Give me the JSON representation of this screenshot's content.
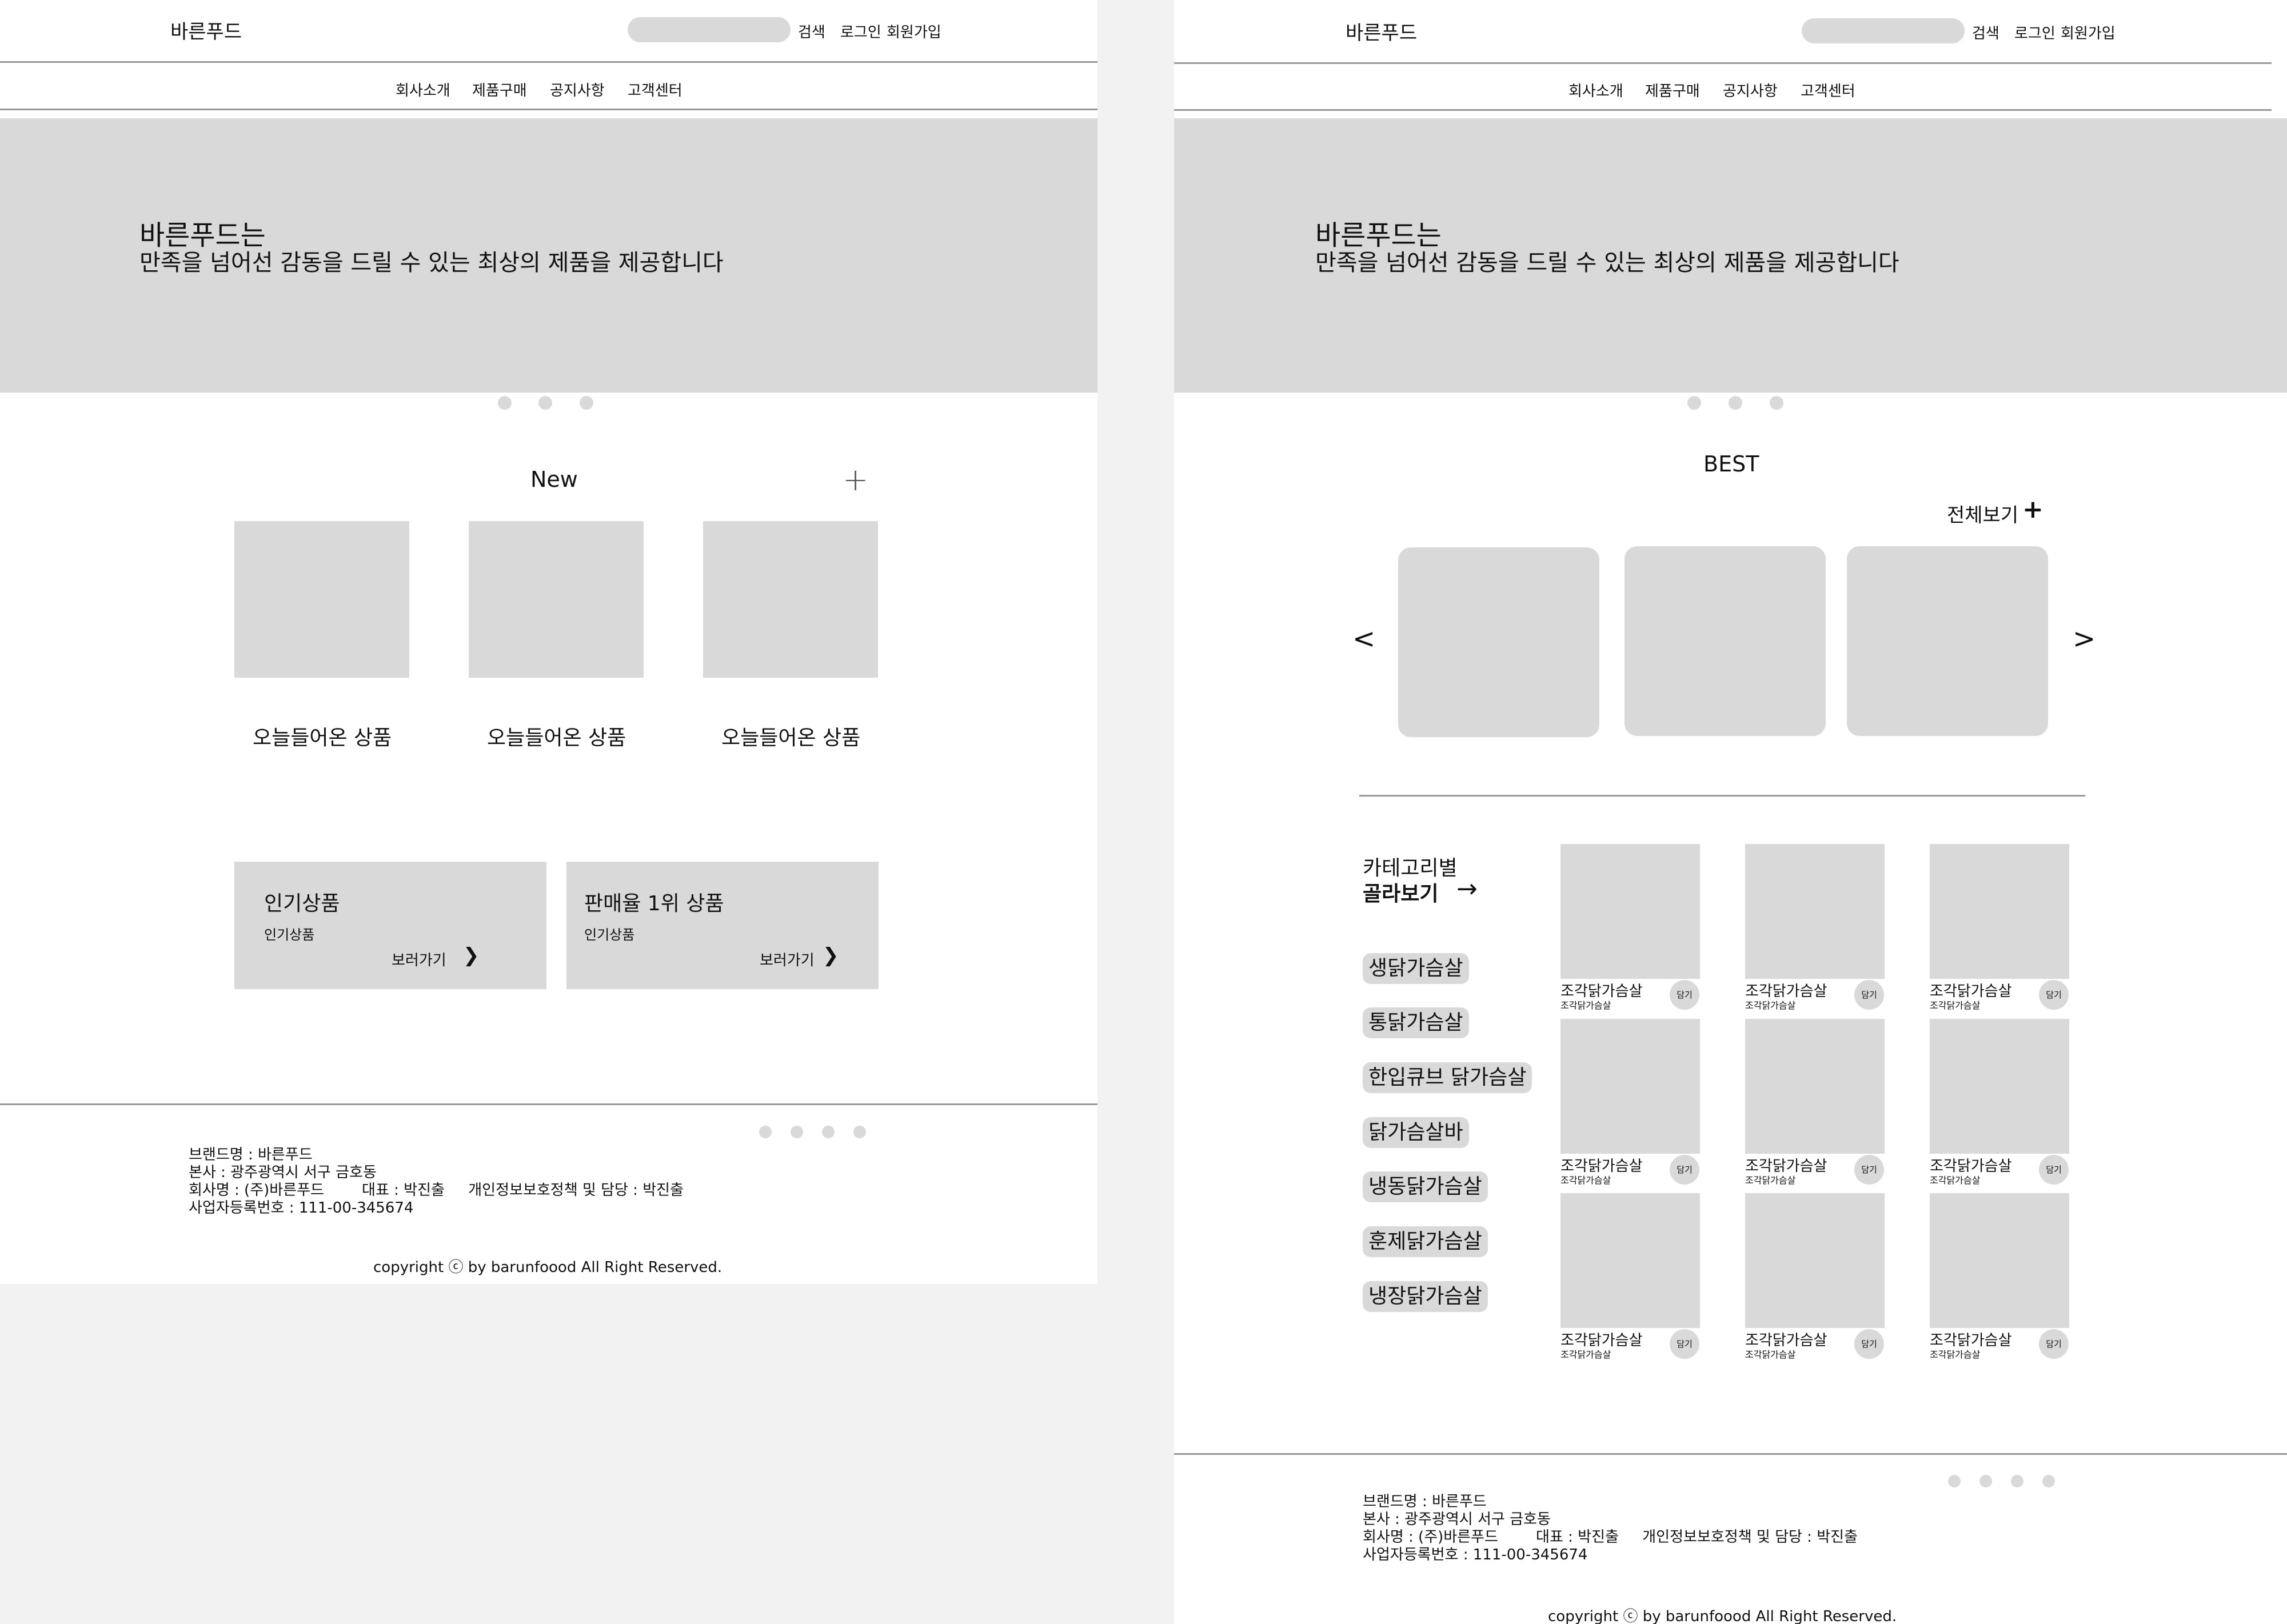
{
  "pageA": {
    "header": {
      "logo": "바른푸드",
      "search_label": "검색",
      "login": "로그인",
      "signup": "회원가입"
    },
    "nav": [
      "회사소개",
      "제품구매",
      "공지사항",
      "고객센터"
    ],
    "hero": {
      "title": "바른푸드는",
      "subtitle": "만족을 넘어선 감동을 드릴 수 있는 최상의 제품을 제공합니다"
    },
    "new_section": {
      "title": "New",
      "plus": "+",
      "items": [
        {
          "label": "오늘들어온 상품"
        },
        {
          "label": "오늘들어온 상품"
        },
        {
          "label": "오늘들어온 상품"
        }
      ]
    },
    "promo": [
      {
        "title": "인기상품",
        "sub": "인기상품",
        "link": "보러가기",
        "arrow": "❯"
      },
      {
        "title": "판매율 1위 상품",
        "sub": "인기상품",
        "link": "보러가기",
        "arrow": "❯"
      }
    ],
    "footer": {
      "brand": "브랜드명 : 바른푸드",
      "hq": "본사 : 광주광역시 서구 금호동",
      "company": "회사명 : (주)바른푸드        대표 : 박진출     개인정보보호정책 및 담당 : 박진출",
      "bizno": "사업자등록번호 : 111-00-345674",
      "copyright": "copyright ⓒ by barunfoood All Right Reserved."
    }
  },
  "pageB": {
    "header": {
      "logo": "바른푸드",
      "search_label": "검색",
      "login": "로그인",
      "signup": "회원가입"
    },
    "nav": [
      "회사소개",
      "제품구매",
      "공지사항",
      "고객센터"
    ],
    "hero": {
      "title": "바른푸드는",
      "subtitle": "만족을 넘어선 감동을 드릴 수 있는 최상의 제품을 제공합니다"
    },
    "best": {
      "title": "BEST",
      "view_all": "전체보기",
      "view_all_icon": "+",
      "prev": "<",
      "next": ">"
    },
    "category": {
      "heading_line1": "카테고리별",
      "heading_line2": "골라보기",
      "arrow": "→",
      "tags": [
        "생닭가슴살",
        "통닭가슴살",
        "한입큐브 닭가슴살",
        "닭가슴살바",
        "냉동닭가슴살",
        "훈제닭가슴살",
        "냉장닭가슴살"
      ]
    },
    "products": [
      {
        "name": "조각닭가슴살",
        "sub": "조각닭가슴살",
        "cart": "담기"
      },
      {
        "name": "조각닭가슴살",
        "sub": "조각닭가슴살",
        "cart": "담기"
      },
      {
        "name": "조각닭가슴살",
        "sub": "조각닭가슴살",
        "cart": "담기"
      },
      {
        "name": "조각닭가슴살",
        "sub": "조각닭가슴살",
        "cart": "담기"
      },
      {
        "name": "조각닭가슴살",
        "sub": "조각닭가슴살",
        "cart": "담기"
      },
      {
        "name": "조각닭가슴살",
        "sub": "조각닭가슴살",
        "cart": "담기"
      },
      {
        "name": "조각닭가슴살",
        "sub": "조각닭가슴살",
        "cart": "담기"
      },
      {
        "name": "조각닭가슴살",
        "sub": "조각닭가슴살",
        "cart": "담기"
      },
      {
        "name": "조각닭가슴살",
        "sub": "조각닭가슴살",
        "cart": "담기"
      }
    ],
    "footer": {
      "brand": "브랜드명 : 바른푸드",
      "hq": "본사 : 광주광역시 서구 금호동",
      "company": "회사명 : (주)바른푸드        대표 : 박진출     개인정보보호정책 및 담당 : 박진출",
      "bizno": "사업자등록번호 : 111-00-345674",
      "copyright": "copyright ⓒ by barunfoood All Right Reserved."
    }
  }
}
